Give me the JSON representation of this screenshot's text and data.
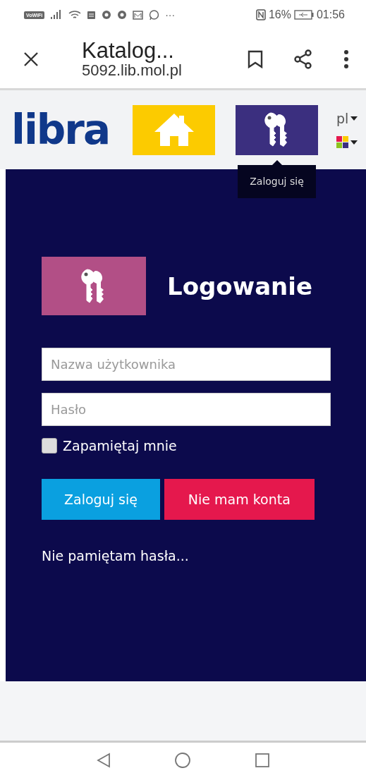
{
  "status_bar": {
    "badge": "VoWiFi",
    "overflow": "···",
    "battery": "16%",
    "time": "01:56"
  },
  "browser": {
    "title": "Katalog...",
    "url": "5092.lib.mol.pl"
  },
  "header": {
    "logo": "libra",
    "language": "pl",
    "tooltip": "Zaloguj się"
  },
  "login": {
    "title": "Logowanie",
    "username": {
      "placeholder": "Nazwa użytkownika"
    },
    "password": {
      "placeholder": "Hasło"
    },
    "remember": {
      "label": "Zapamiętaj mnie",
      "checked": false
    },
    "buttons": [
      {
        "label": "Zaloguj się",
        "kind": "primary"
      },
      {
        "label": "Nie mam konta",
        "kind": "danger"
      }
    ],
    "forgot": "Nie pamiętam hasła..."
  }
}
